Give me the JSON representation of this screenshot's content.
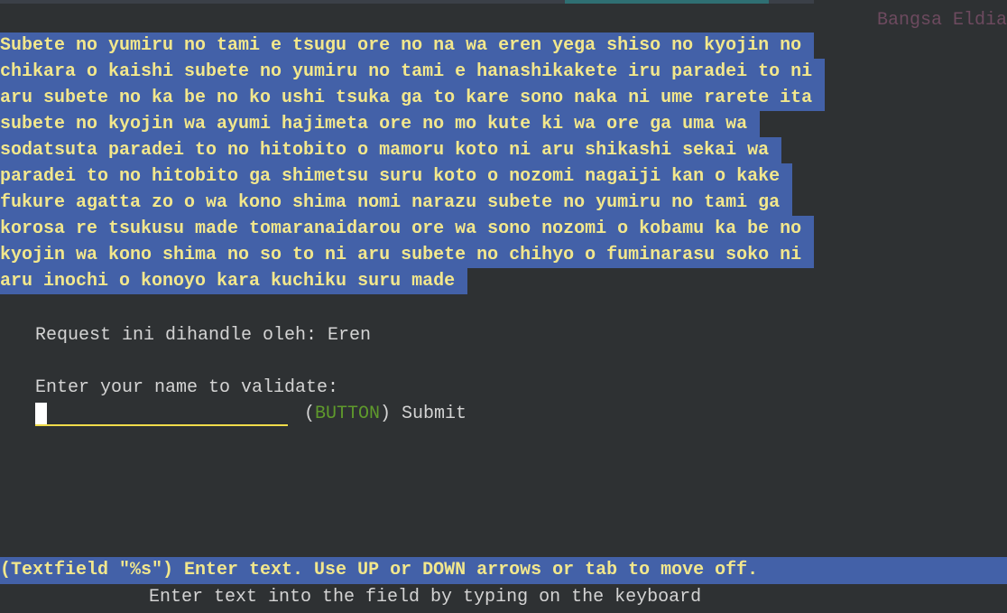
{
  "header": {
    "title": "Bangsa Eldia"
  },
  "story": {
    "lines": [
      "Subete no yumiru no tami e tsugu ore no na wa eren yega shiso no kyojin no",
      "chikara o kaishi subete no yumiru no tami e hanashikakete iru paradei to ni",
      "aru subete no ka be no ko ushi tsuka ga to kare sono naka ni ume rarete ita",
      "subete no kyojin wa ayumi hajimeta ore no mo kute ki wa ore ga uma wa",
      "sodatsuta paradei to no hitobito o mamoru koto ni aru shikashi sekai wa",
      "paradei to no hitobito ga shimetsu suru koto o nozomi nagaiji kan o kake",
      "fukure agatta zo o wa kono shima nomi narazu subete no yumiru no tami ga",
      "korosa re tsukusu made tomaranaidarou ore wa sono nozomi o kobamu ka be no",
      "kyojin wa kono shima no so to ni aru subete no chihyo o fuminarasu soko ni",
      "aru inochi o konoyo kara kuchiku suru made"
    ]
  },
  "request": {
    "text": "Request ini dihandle oleh: Eren"
  },
  "form": {
    "prompt": "Enter your name to validate:",
    "field_value": "",
    "button_open": "(",
    "button_kind": "BUTTON",
    "button_close": ")",
    "submit_label": "Submit"
  },
  "status": {
    "text": "(Textfield \"%s\") Enter text. Use UP or DOWN arrows or tab to move off.",
    "hint": "Enter text into the field by typing on the keyboard"
  },
  "colors": {
    "background": "#2e3133",
    "highlight": "#4361a8",
    "highlight_text": "#f2e78c",
    "title": "#6d4a5f",
    "button_kind": "#5f9a2c",
    "field_underline": "#f0dc4a"
  }
}
